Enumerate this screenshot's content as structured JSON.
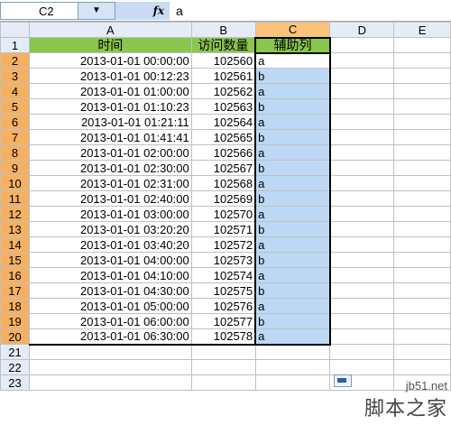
{
  "formula_bar": {
    "name_box": "C2",
    "dropdown_icon": "▼",
    "fx_label": "fx",
    "value": "a"
  },
  "columns": [
    "A",
    "B",
    "C",
    "D",
    "E"
  ],
  "header_row": {
    "row_number": "1",
    "A": "时间",
    "B": "访问数量",
    "C": "辅助列"
  },
  "rows": [
    {
      "n": "2",
      "time": "2013-01-01  00:00:00",
      "count": "102560",
      "helper": "a"
    },
    {
      "n": "3",
      "time": "2013-01-01  00:12:23",
      "count": "102561",
      "helper": "b"
    },
    {
      "n": "4",
      "time": "2013-01-01  01:00:00",
      "count": "102562",
      "helper": "a"
    },
    {
      "n": "5",
      "time": "2013-01-01  01:10:23",
      "count": "102563",
      "helper": "b"
    },
    {
      "n": "6",
      "time": "2013-01-01  01:21:11",
      "count": "102564",
      "helper": "a"
    },
    {
      "n": "7",
      "time": "2013-01-01  01:41:41",
      "count": "102565",
      "helper": "b"
    },
    {
      "n": "8",
      "time": "2013-01-01  02:00:00",
      "count": "102566",
      "helper": "a"
    },
    {
      "n": "9",
      "time": "2013-01-01  02:30:00",
      "count": "102567",
      "helper": "b"
    },
    {
      "n": "10",
      "time": "2013-01-01  02:31:00",
      "count": "102568",
      "helper": "a"
    },
    {
      "n": "11",
      "time": "2013-01-01  02:40:00",
      "count": "102569",
      "helper": "b"
    },
    {
      "n": "12",
      "time": "2013-01-01  03:00:00",
      "count": "102570",
      "helper": "a"
    },
    {
      "n": "13",
      "time": "2013-01-01  03:20:20",
      "count": "102571",
      "helper": "b"
    },
    {
      "n": "14",
      "time": "2013-01-01  03:40:20",
      "count": "102572",
      "helper": "a"
    },
    {
      "n": "15",
      "time": "2013-01-01  04:00:00",
      "count": "102573",
      "helper": "b"
    },
    {
      "n": "16",
      "time": "2013-01-01  04:10:00",
      "count": "102574",
      "helper": "a"
    },
    {
      "n": "17",
      "time": "2013-01-01  04:30:00",
      "count": "102575",
      "helper": "b"
    },
    {
      "n": "18",
      "time": "2013-01-01  05:00:00",
      "count": "102576",
      "helper": "a"
    },
    {
      "n": "19",
      "time": "2013-01-01  06:00:00",
      "count": "102577",
      "helper": "b"
    },
    {
      "n": "20",
      "time": "2013-01-01  06:30:00",
      "count": "102578",
      "helper": "a"
    }
  ],
  "empty_rows": [
    "21",
    "22",
    "23"
  ],
  "watermark": {
    "site": "jb51.net",
    "name": "脚本之家"
  }
}
